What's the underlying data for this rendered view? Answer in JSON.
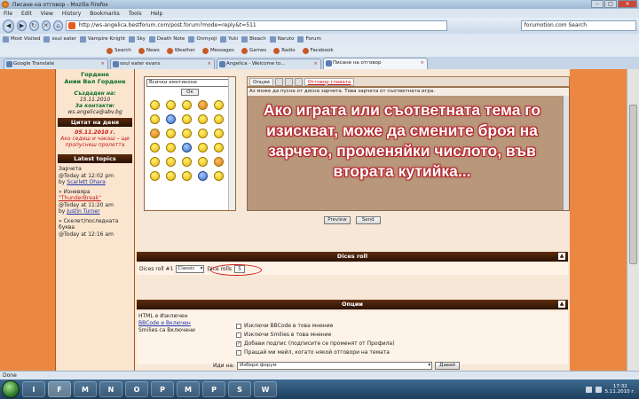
{
  "window": {
    "title": "Писане на отговор - Mozilla Firefox"
  },
  "menu": [
    "File",
    "Edit",
    "View",
    "History",
    "Bookmarks",
    "Tools",
    "Help"
  ],
  "nav": {
    "url": "http://ws-angelica.bestforum.com/post.forum?mode=reply&t=511",
    "search_placeholder": "forumotion.com Search"
  },
  "bookmarks": [
    "Most Visited",
    "soul eater",
    "Vampire Knight",
    "Sky",
    "Death Note",
    "Onmyoji",
    "Yuki",
    "Bleach",
    "Naruto",
    "Forum"
  ],
  "toolbar2": [
    "Search",
    "News",
    "Weather",
    "Messages",
    "Games",
    "Radio",
    "Facebook"
  ],
  "tabs": [
    {
      "label": "Google Translate"
    },
    {
      "label": "soul eater evans"
    },
    {
      "label": "Angelica - Welcome to..."
    },
    {
      "label": "Писане на отговор"
    }
  ],
  "left": {
    "names": "Гордене\nАнии Вал Гордене",
    "created_label": "Създаден на:",
    "created_date": "15.11.2010",
    "for_contacts": "За контакти:",
    "contact_email": "ws.angelica@abv.bg",
    "quote_header": "Цитат на деня",
    "quote_date": "05.11.2010 г.",
    "quote_text": "Ако седиш и чакаш – ще пропуснеш пролетта",
    "latest_header": "Latest topics",
    "topic1_title": "Зарчета",
    "topic1_meta": "@Today at 12:02 pm",
    "topic1_by": "by",
    "topic1_user": "Scarlett Ohara",
    "topic2_title": "» Изневяра",
    "topic2_link": "\"ThunderBreak\"",
    "topic2_meta": "@Today at 11:20 am",
    "topic2_by": "by",
    "topic2_user": "Justin Turner",
    "topic3_title": "» Скелет/последната",
    "topic3_sub": "буква",
    "topic3_meta": "@Today at 12:16 am"
  },
  "smilies": {
    "select_label": "Всички емотикони",
    "ok_label": "Ок",
    "count": 30
  },
  "editor": {
    "tab_source": "Опции",
    "tab_active": "Отговор главата",
    "first_line": "Аз може да пусна от дясна зарчета. Това зарчета от съответната игра.",
    "overlay": "Ако играта или съответната тема го изискват, може да смените броя на зарчето, променяйки числото, във втората кутийка..."
  },
  "buttons": {
    "preview": "Preview",
    "send": "Send"
  },
  "dice": {
    "header": "Dices roll",
    "row_label": "Dices roll #1",
    "select_value": "Classic",
    "rolls_label": "Dice rolls",
    "rolls_value": "5"
  },
  "options": {
    "header": "Опции",
    "html_label": "HTML е Изключен",
    "bbcode_label": "BBCode е Включен",
    "smilies_label": "Smilies са Включени",
    "opt1": "Изключи BBCode в това мнение",
    "opt2": "Изключи Smilies в това мнение",
    "opt3": "Добави подпис (подписите се променят от Профила)",
    "opt4": "Пращай ми мейл, когато някой отговори на темата"
  },
  "goto": {
    "label": "Иди на:",
    "value": "Избери форум",
    "go": "Давай"
  },
  "status": {
    "text": "Done"
  },
  "taskbar": {
    "apps": [
      "IE",
      "Firefox",
      "Media",
      "Norton",
      "Opera",
      "Paint",
      "Messenger",
      "PS",
      "Skype",
      "Word"
    ],
    "clock_time": "17:32",
    "clock_date": "5.11.2010 г."
  }
}
